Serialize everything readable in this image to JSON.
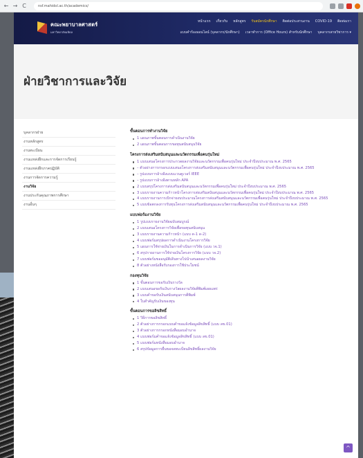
{
  "browser": {
    "url": "nsf.mahidol.ac.th/academics/",
    "back_glyph": "←",
    "forward_glyph": "→",
    "reload_glyph": "C"
  },
  "site": {
    "logo_line1": "คณะพยาบาลศาสตร์",
    "logo_line2": "มหาวิทยาลัยมหิดล",
    "menu_row1": [
      "หน้าแรก",
      "เกี่ยวกับ",
      "หลักสูตร",
      "รับสมัครนักศึกษา",
      "ติดต่อประสานงาน",
      "COVID-19",
      "ติดต่อเรา"
    ],
    "menu_row1_active": 3,
    "menu_row2": [
      "แบบคำร้องออนไลน์ (บุคลากร/นักศึกษา)",
      "เวลาทำการ (Office Hours) สำหรับนักศึกษา",
      "บุคลากรสายวิชาการ ▾"
    ]
  },
  "page": {
    "title": "ฝ่ายวิชาการและวิจัย"
  },
  "sidebar": {
    "items": [
      {
        "label": "บุคลากรฝ่าย"
      },
      {
        "label": "งานหลักสูตร"
      },
      {
        "label": "งานทะเบียน"
      },
      {
        "label": "งานแหล่งฝึกและการจัดการเรียนรู้"
      },
      {
        "label": "งานแหล่งฝึกภาคปฏิบัติ"
      },
      {
        "label": "งานการจัดการความรู้"
      },
      {
        "label": "งานวิจัย"
      },
      {
        "label": "งานประกันคุณภาพการศึกษา"
      },
      {
        "label": "งานอื่นๆ"
      }
    ],
    "active_index": 6
  },
  "main": {
    "sections": [
      {
        "heading": "ขั้นตอนการทำงานวิจัย",
        "items": [
          "1 แผนภาพขั้นตอนการดำเนินงานวิจัย",
          "2 แผนภาพขั้นตอนการขอทุนสนับสนุนวิจัย"
        ]
      },
      {
        "heading": "โครงการส่งเสริมสนับสนุนและนวัตกรรมเพื่อคนรุ่นใหม่",
        "items": [
          "1 แบบเสนอโครงการประกวดผลงานวิจัยและนวัตกรรมเพื่อคนรุ่นใหม่ ประจำปีงบประมาณ พ.ศ. 2565",
          "– ตัวอย่างการกรอกแบบเสนอโครงการส่งเสริมสนับสนุนและนวัตกรรมเพื่อคนรุ่นใหม่ ประจำปีงบประมาณ พ.ศ. 2565",
          "– รูปแบบการอ้างอิงแบบแวนคูเวอร์ IEEE",
          "– รูปแบบการอ้างอิงตามหลัก APA",
          "2 แบบสรุปโครงการส่งเสริมสนับสนุนและนวัตกรรมเพื่อคนรุ่นใหม่ ประจำปีงบประมาณ พ.ศ. 2565",
          "3 แบบรายงานความก้าวหน้าโครงการส่งเสริมสนับสนุนและนวัตกรรมเพื่อคนรุ่นใหม่ ประจำปีงบประมาณ พ.ศ. 2565",
          "4 แบบรายงานการเบิกจ่ายงบประมาณโครงการส่งเสริมสนับสนุนและนวัตกรรมเพื่อคนรุ่นใหม่ ประจำปีงบประมาณ พ.ศ. 2565",
          "5 แบบข้อตกลงการรับทุนโครงการส่งเสริมสนับสนุนและนวัตกรรมเพื่อคนรุ่นใหม่ ประจำปีงบประมาณ พ.ศ. 2565"
        ]
      },
      {
        "heading": "แบบฟอร์มงานวิจัย",
        "items": [
          "1 รูปแบบรายงานวิจัยฉบับสมบูรณ์",
          "2 แบบเสนอโครงการวิจัยเพื่อขอทุนสนับสนุน",
          "3 แบบรายงานความก้าวหน้า (แบบ ค-1 ด-2)",
          "4 แบบฟอร์มสรุปผลการดำเนินงานโครงการวิจัย",
          "5 แผนการใช้จ่ายเงินในการดำเนินการวิจัย (แบบ วจ.1)",
          "6 สรุปรายงานการใช้จ่ายเงินโครงการวิจัย (แบบ วจ.2)",
          "7 แบบฟอร์มขออนุมัติเดินทางไปนำเสนอผลงานวิจัย",
          "8 ตัวอย่างหนังสือรับรองการใช้ประโยชน์"
        ]
      },
      {
        "heading": "กองทุนวิจัย",
        "items": [
          "1 ขั้นตอนการขอรับเงินรางวัล",
          "2 แบบเสนอขอรับเงินรางวัลผลงานวิจัยตีพิมพ์เผยแพร่",
          "3 แบบคำขอรับเงินสนับสนุนการตีพิมพ์",
          "4 ใบสำคัญรับเงินของทุน"
        ]
      },
      {
        "heading": "ขั้นตอนการขอลิขสิทธิ์",
        "items": [
          "1 วิธีการขอลิขสิทธิ์",
          "2 ตัวอย่างการกรอกแบบคำขอแจ้งข้อมูลลิขสิทธิ์ (แบบ ลข.01)",
          "3 ตัวอย่างการกรอกหนังสือมอบอำนาจ",
          "4 แบบฟอร์มคำขอแจ้งข้อมูลลิขสิทธิ์ (แบบ ลข.01)",
          "5 แบบฟอร์มหนังสือมอบอำนาจ",
          "6 สรุปข้อมูลการยื่นขอจดทะเบียนลิขสิทธิ์ผลงานวิจัย"
        ]
      }
    ]
  },
  "scroll_top": {
    "glyph": "^"
  },
  "colors": {
    "header": "#1b2358",
    "link": "#7b4dbb",
    "active_menu": "#f5c518",
    "scroll_button": "#7e57c2"
  }
}
